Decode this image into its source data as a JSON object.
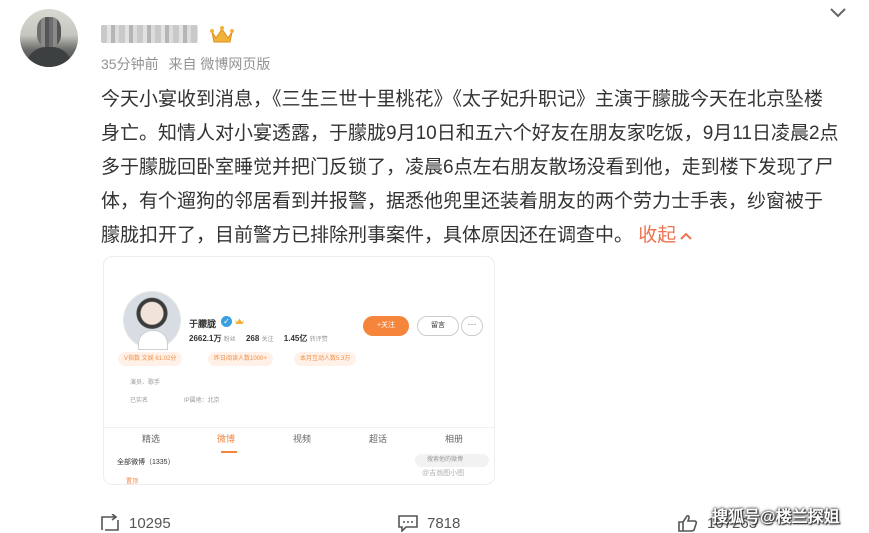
{
  "post": {
    "time": "35分钟前",
    "source": "来自 微博网页版",
    "text": "今天小宴收到消息，《三生三世十里桃花》《太子妃升职记》主演于朦胧今天在北京坠楼身亡。知情人对小宴透露，于朦胧9月10日和五六个好友在朋友家吃饭，9月11日凌晨2点多于朦胧回卧室睡觉并把门反锁了，凌晨6点左右朋友散场没看到他，走到楼下发现了尸体，有个遛狗的邻居看到并报警，据悉他兜里还装着朋友的两个劳力士手表，纱窗被于朦胧扣开了，目前警方已排除刑事案件，具体原因还在调查中。",
    "collapse_label": "收起"
  },
  "profile_card": {
    "name": "于朦胧",
    "followers": "2662.1万",
    "followers_label": "粉丝",
    "following": "268",
    "following_label": "关注",
    "likes": "1.45亿",
    "likes_label": "转评赞",
    "follow_label": "+关注",
    "message_label": "留言",
    "more_label": "···",
    "tags": [
      "V指数 文娱 61.02分",
      "昨日阅读人数1000+",
      "本月互动人数5.3万"
    ],
    "info_occupation": "演员、歌手",
    "info_verified": "已实名",
    "info_location": "IP属地：北京",
    "tabs": [
      "精选",
      "微博",
      "视频",
      "超话",
      "相册"
    ],
    "all_posts": "全部微博（1335）",
    "search_placeholder": "搜索他的微博",
    "pinned": "置顶",
    "watermark": "@吉翁图小图"
  },
  "actions": {
    "repost_count": "10295",
    "comment_count": "7818",
    "like_count": "107263"
  },
  "source_watermark": "搜狐号@楼兰探姐",
  "colors": {
    "accent": "#eb7350",
    "orange": "#f4853a"
  }
}
